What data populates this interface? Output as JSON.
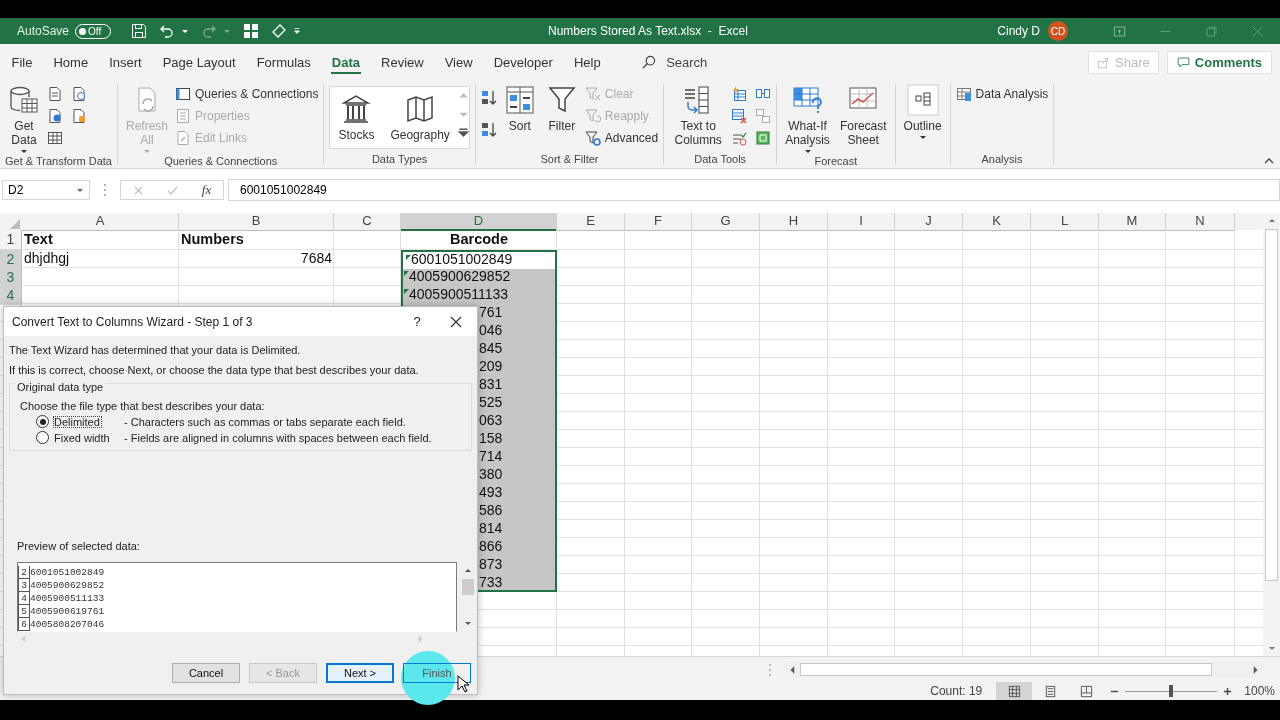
{
  "title_bar": {
    "autosave_label": "AutoSave",
    "autosave": {
      "on": false,
      "label": "Off"
    },
    "title": "Numbers Stored As Text.xlsx  -  Excel",
    "user_name": "Cindy D",
    "user_initials": "CD"
  },
  "ribbon_tabs": [
    {
      "label": "File",
      "selected": false
    },
    {
      "label": "Home",
      "selected": false
    },
    {
      "label": "Insert",
      "selected": false
    },
    {
      "label": "Page Layout",
      "selected": false
    },
    {
      "label": "Formulas",
      "selected": false
    },
    {
      "label": "Data",
      "selected": true
    },
    {
      "label": "Review",
      "selected": false
    },
    {
      "label": "View",
      "selected": false
    },
    {
      "label": "Developer",
      "selected": false
    },
    {
      "label": "Help",
      "selected": false
    }
  ],
  "search": {
    "placeholder": "Search"
  },
  "share_button": {
    "label": "Share",
    "disabled": true
  },
  "comments_button": {
    "label": "Comments"
  },
  "ribbon_groups": [
    {
      "label": "Get & Transform Data",
      "commands": [
        {
          "kind": "large",
          "label": "Get Data",
          "dropdown": true,
          "disabled": false
        }
      ]
    },
    {
      "label": "Queries & Connections",
      "commands": [
        {
          "kind": "large",
          "label": "Refresh All",
          "dropdown": true,
          "disabled": true
        },
        {
          "kind": "small",
          "label": "Queries & Connections",
          "dropdown": false,
          "disabled": false
        },
        {
          "kind": "small",
          "label": "Properties",
          "dropdown": false,
          "disabled": true
        },
        {
          "kind": "small",
          "label": "Edit Links",
          "dropdown": false,
          "disabled": true
        }
      ]
    },
    {
      "label": "Data Types",
      "commands": [
        {
          "kind": "gallery",
          "label": "Stocks"
        },
        {
          "kind": "gallery",
          "label": "Geography"
        }
      ]
    },
    {
      "label": "Sort & Filter",
      "commands": [
        {
          "kind": "large",
          "label": "Sort",
          "dropdown": false,
          "disabled": false
        },
        {
          "kind": "large",
          "label": "Filter",
          "dropdown": false,
          "disabled": false
        },
        {
          "kind": "small",
          "label": "Clear",
          "dropdown": false,
          "disabled": true
        },
        {
          "kind": "small",
          "label": "Reapply",
          "dropdown": false,
          "disabled": true
        },
        {
          "kind": "small",
          "label": "Advanced",
          "dropdown": false,
          "disabled": false
        }
      ]
    },
    {
      "label": "Data Tools",
      "commands": [
        {
          "kind": "large",
          "label": "Text to Columns",
          "dropdown": false,
          "disabled": false
        }
      ]
    },
    {
      "label": "Forecast",
      "commands": [
        {
          "kind": "large",
          "label": "What-If Analysis",
          "dropdown": true,
          "disabled": false
        },
        {
          "kind": "large",
          "label": "Forecast Sheet",
          "dropdown": false,
          "disabled": false
        }
      ]
    },
    {
      "commands": [
        {
          "kind": "large",
          "label": "Outline",
          "dropdown": true,
          "disabled": false
        }
      ]
    },
    {
      "label": "Analysis",
      "commands": [
        {
          "kind": "small",
          "label": "Data Analysis",
          "dropdown": false,
          "disabled": false
        }
      ]
    }
  ],
  "formula_bar": {
    "name_box": "D2",
    "function_label": "fx",
    "value": "6001051002849"
  },
  "sheet": {
    "columns": [
      {
        "label": "A",
        "selected": false
      },
      {
        "label": "B",
        "selected": false
      },
      {
        "label": "C",
        "selected": false
      },
      {
        "label": "D",
        "selected": true
      },
      {
        "label": "E",
        "selected": false
      },
      {
        "label": "F",
        "selected": false
      },
      {
        "label": "G",
        "selected": false
      },
      {
        "label": "H",
        "selected": false
      },
      {
        "label": "I",
        "selected": false
      },
      {
        "label": "J",
        "selected": false
      },
      {
        "label": "K",
        "selected": false
      },
      {
        "label": "L",
        "selected": false
      },
      {
        "label": "M",
        "selected": false
      },
      {
        "label": "N",
        "selected": false
      }
    ],
    "row_headers": [
      {
        "label": "1",
        "selected": false
      },
      {
        "label": "2",
        "selected": true
      },
      {
        "label": "3",
        "selected": true
      },
      {
        "label": "4",
        "selected": true
      }
    ],
    "rows": [
      {
        "column_a": {
          "kind": "heading",
          "text": "Text",
          "selected": false
        },
        "column_b": {
          "kind": "heading",
          "text": "Numbers",
          "selected": false
        },
        "column_d": {
          "kind": "heading_center",
          "text": "Barcode",
          "selected": false
        }
      },
      {
        "column_a": {
          "kind": "text",
          "text": "dhjdhgj",
          "selected": false
        },
        "column_b": {
          "kind": "number",
          "text": "7684",
          "selected": false
        },
        "column_d": {
          "kind": "text",
          "text": "6001051002849",
          "selected": true,
          "active": true,
          "flag": true
        }
      },
      {
        "column_d": {
          "kind": "text",
          "text": "4005900629852",
          "selected": true,
          "active": false,
          "flag": true
        }
      },
      {
        "column_d": {
          "kind": "text",
          "text": "4005900511133",
          "selected": true,
          "active": false,
          "flag": true
        }
      },
      {
        "column_d": {
          "kind": "partial",
          "text": "761",
          "selected": true,
          "active": false
        }
      },
      {
        "column_d": {
          "kind": "partial",
          "text": "046",
          "selected": true,
          "active": false
        }
      },
      {
        "column_d": {
          "kind": "partial",
          "text": "845",
          "selected": true,
          "active": false
        }
      },
      {
        "column_d": {
          "kind": "partial",
          "text": "209",
          "selected": true,
          "active": false
        }
      },
      {
        "column_d": {
          "kind": "partial",
          "text": "831",
          "selected": true,
          "active": false
        }
      },
      {
        "column_d": {
          "kind": "partial",
          "text": "525",
          "selected": true,
          "active": false
        }
      },
      {
        "column_d": {
          "kind": "partial",
          "text": "063",
          "selected": true,
          "active": false
        }
      },
      {
        "column_d": {
          "kind": "partial",
          "text": "158",
          "selected": true,
          "active": false
        }
      },
      {
        "column_d": {
          "kind": "partial",
          "text": "714",
          "selected": true,
          "active": false
        }
      },
      {
        "column_d": {
          "kind": "partial",
          "text": "380",
          "selected": true,
          "active": false
        }
      },
      {
        "column_d": {
          "kind": "partial",
          "text": "493",
          "selected": true,
          "active": false
        }
      },
      {
        "column_d": {
          "kind": "partial",
          "text": "586",
          "selected": true,
          "active": false
        }
      },
      {
        "column_d": {
          "kind": "partial",
          "text": "814",
          "selected": true,
          "active": false
        }
      },
      {
        "column_d": {
          "kind": "partial",
          "text": "866",
          "selected": true,
          "active": false
        }
      },
      {
        "column_d": {
          "kind": "partial",
          "text": "873",
          "selected": true,
          "active": false
        }
      },
      {
        "column_d": {
          "kind": "partial",
          "text": "733",
          "selected": true,
          "active": false
        }
      }
    ]
  },
  "dialog": {
    "title": "Convert Text to Columns Wizard - Step 1 of 3",
    "help": "?",
    "intro": [
      "The Text Wizard has determined that your data is Delimited.",
      "If this is correct, choose Next, or choose the data type that best describes your data."
    ],
    "group_label": "Original data type",
    "prompt": "Choose the file type that best describes your data:",
    "options": [
      {
        "label": "Delimited",
        "description": "- Characters such as commas or tabs separate each field.",
        "selected": true
      },
      {
        "label": "Fixed width",
        "description": "- Fields are aligned in columns with spaces between each field.",
        "selected": false
      }
    ],
    "preview_label": "Preview of selected data:",
    "preview_rows": [
      {
        "number": "2",
        "text": "6001051002849"
      },
      {
        "number": "3",
        "text": "4005900629852"
      },
      {
        "number": "4",
        "text": "4005900511133"
      },
      {
        "number": "5",
        "text": "4005900619761"
      },
      {
        "number": "6",
        "text": "4005808207046"
      }
    ],
    "buttons": [
      {
        "label": "Cancel",
        "kind": "normal"
      },
      {
        "label": "< Back",
        "kind": "disabled"
      },
      {
        "label": "Next >",
        "kind": "default"
      },
      {
        "label": "Finish",
        "kind": "clicked"
      }
    ]
  },
  "status_bar": {
    "count": "Count: 19",
    "views": [
      {
        "selected": true
      },
      {
        "selected": false
      },
      {
        "selected": false
      }
    ],
    "zoom": {
      "level": 0.5,
      "reading": "100%"
    }
  }
}
